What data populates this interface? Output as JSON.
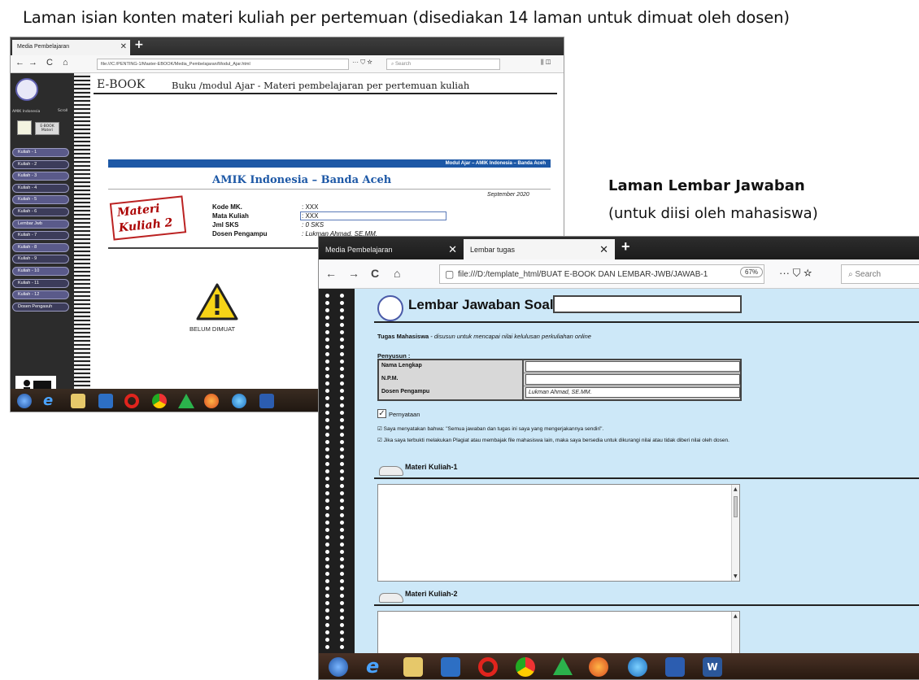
{
  "captions": {
    "top": "Laman isian konten materi kuliah per pertemuan (disediakan 14 laman untuk dimuat oleh dosen)",
    "right_title": "Laman Lembar Jawaban",
    "right_sub": "(untuk diisi oleh mahasiswa)"
  },
  "win1": {
    "tab_title": "Media Pembelajaran",
    "url": "file:///C:/PENTING-1/Master-EBOOK/Media_Pembelajaran/Modul_Ajar.html",
    "search_placeholder": "Search",
    "logo_label": "AMIK Indonesia",
    "logo_tiny": "Scroll",
    "ebook_button": "E-BOOK Materi",
    "sidebar_items": [
      "Kuliah - 1",
      "Kuliah - 2",
      "Kuliah - 3",
      "Kuliah - 4",
      "Kuliah - 5",
      "Kuliah - 6",
      "Lembar Jwb",
      "Kuliah - 7",
      "Kuliah - 8",
      "Kuliah - 9",
      "Kuliah - 10",
      "Kuliah - 11",
      "Kuliah - 12",
      "Dosen Pengasuh"
    ],
    "ebook_title": "E-BOOK",
    "ebook_subtitle": "Buku /modul Ajar - Materi pembelajaran per pertemuan kuliah",
    "blue_bar": "Modul Ajar – AMIK Indonesia – Banda Aceh",
    "institution": "AMIK Indonesia – Banda Aceh",
    "date": "September 2020",
    "materi_line1": "Materi",
    "materi_line2": "Kuliah 2",
    "info": [
      {
        "label": "Kode MK.",
        "value": ":  XXX"
      },
      {
        "label": "Mata Kuliah",
        "value": ":  XXX"
      },
      {
        "label": "Jml SKS",
        "value": ":  0 SKS"
      },
      {
        "label": "Dosen Pengampu",
        "value": ":  Lukman Ahmad, SE.MM."
      }
    ],
    "belum": "BELUM DIMUAT"
  },
  "win2": {
    "tab1": "Media Pembelajaran",
    "tab2": "Lembar tugas",
    "url": "file:///D:/template_html/BUAT E-BOOK DAN LEMBAR-JWB/JAWAB-1",
    "zoom": "67%",
    "search_placeholder": "Search",
    "title": "Lembar Jawaban Soal",
    "tugas_bold": "Tugas Mahasiswa",
    "tugas_rest": " - disusun untuk mencapai nilai kelulusan perkuliahan online",
    "penyusun": "Penyusun :",
    "table": [
      {
        "label": "Nama Lengkap",
        "value": ""
      },
      {
        "label": "N.P.M.",
        "value": ""
      },
      {
        "label": "Dosen Pengampu",
        "value": "Lukman Ahmad, SE.MM."
      }
    ],
    "pernyataan": "Pernyataan",
    "statement1": "☑ Saya menyatakan bahwa: \"Semua jawaban dan tugas ini saya yang mengerjakannya sendiri\".",
    "statement2": "☑ Jika saya terbukti melakukan Plagiat atau membajak file mahasiswa lain, maka saya bersedia untuk dikurangi nilai atau tidak diberi nilai oleh dosen.",
    "materi1": "Materi Kuliah-1",
    "materi2": "Materi Kuliah-2"
  },
  "colors": {
    "accent_blue": "#1d58a6",
    "answer_bg": "#cde8f8",
    "materi_red": "#a00000"
  }
}
